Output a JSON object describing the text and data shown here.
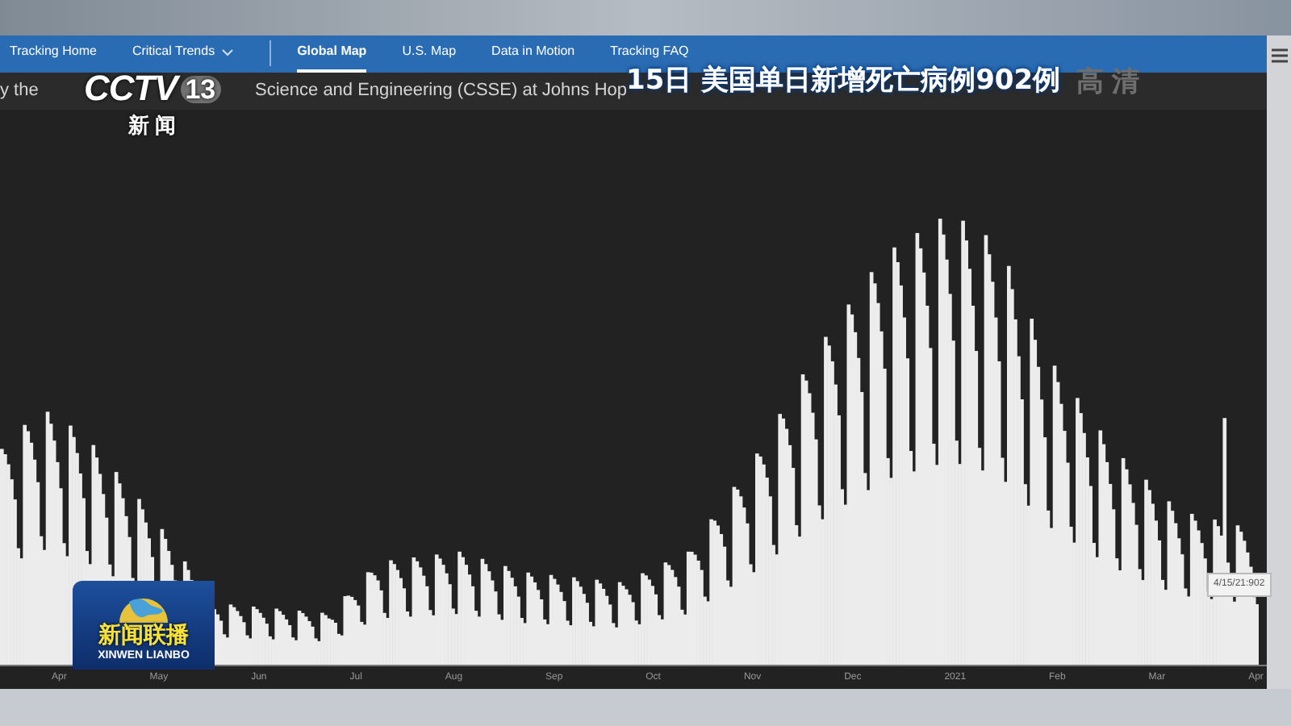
{
  "nav": {
    "items": [
      {
        "label": "Tracking Home",
        "selected": false,
        "kind": "link"
      },
      {
        "label": "Critical Trends",
        "selected": false,
        "kind": "dropdown"
      },
      {
        "label": "Global Map",
        "selected": true,
        "kind": "link"
      },
      {
        "label": "U.S. Map",
        "selected": false,
        "kind": "link"
      },
      {
        "label": "Data in Motion",
        "selected": false,
        "kind": "link"
      },
      {
        "label": "Tracking FAQ",
        "selected": false,
        "kind": "link"
      }
    ]
  },
  "subtitle": [
    "y the",
    "Science and Engineering (CSSE) at Johns Hop"
  ],
  "chart": {
    "x_labels": [
      "Apr",
      "May",
      "Jun",
      "Jul",
      "Aug",
      "Sep",
      "Oct",
      "Nov",
      "Dec",
      "2021",
      "Feb",
      "Mar",
      "Apr"
    ],
    "tooltip": "4/15/21:902"
  },
  "overlays": {
    "channel_logo": {
      "text": "CCTV",
      "number": "13",
      "sub": "新 闻"
    },
    "caption": {
      "headline": "15日 美国单日新增死亡病例902例",
      "quality": "高 清"
    },
    "program_logo": {
      "title": "新闻联播",
      "subtitle": "XINWEN LIANBO"
    }
  }
}
